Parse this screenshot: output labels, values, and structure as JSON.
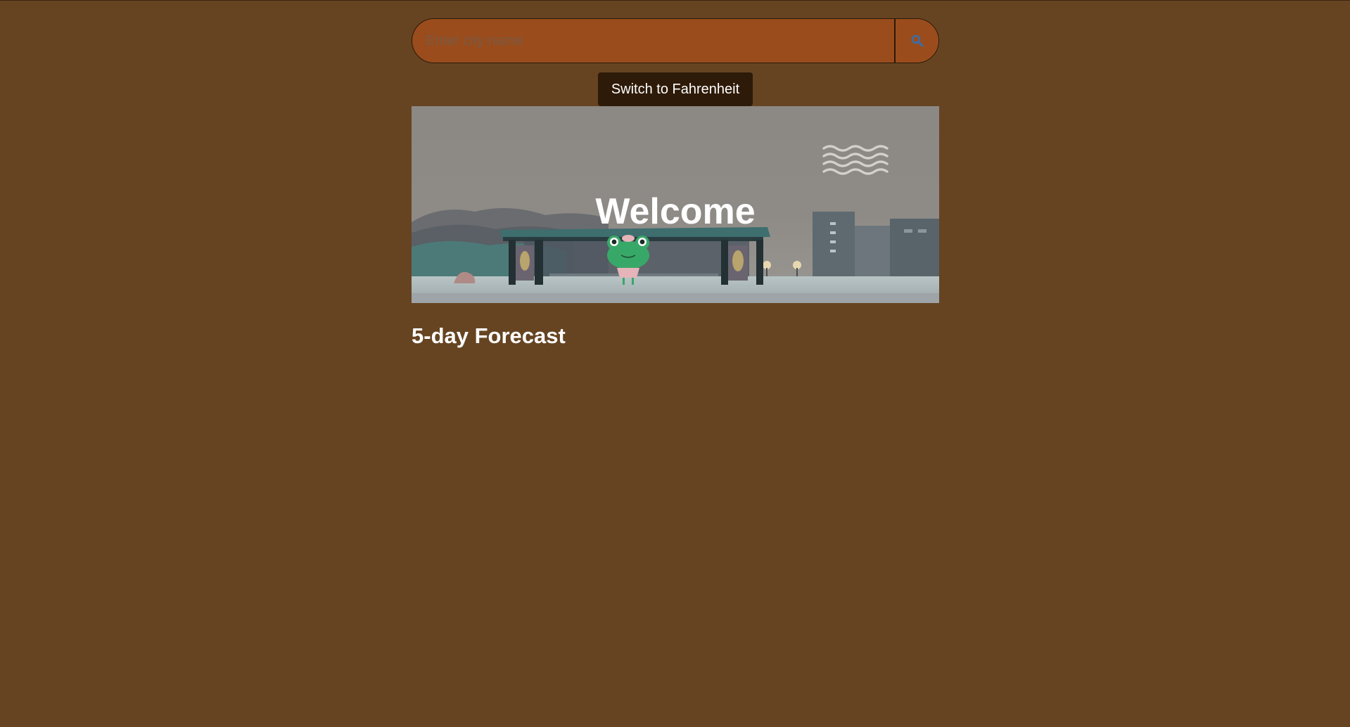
{
  "search": {
    "placeholder": "Enter city name",
    "value": "",
    "button_icon": "search-icon"
  },
  "unit_toggle": {
    "label": "Switch to Fahrenheit"
  },
  "hero": {
    "title": "Welcome",
    "weather_icon": "mist-icon"
  },
  "forecast": {
    "heading": "5-day Forecast",
    "days": []
  },
  "colors": {
    "page_background": "#664422",
    "search_background": "#9a4c1c",
    "button_background": "#2e1a08",
    "search_icon": "#3a6ea8",
    "text": "#ffffff"
  }
}
